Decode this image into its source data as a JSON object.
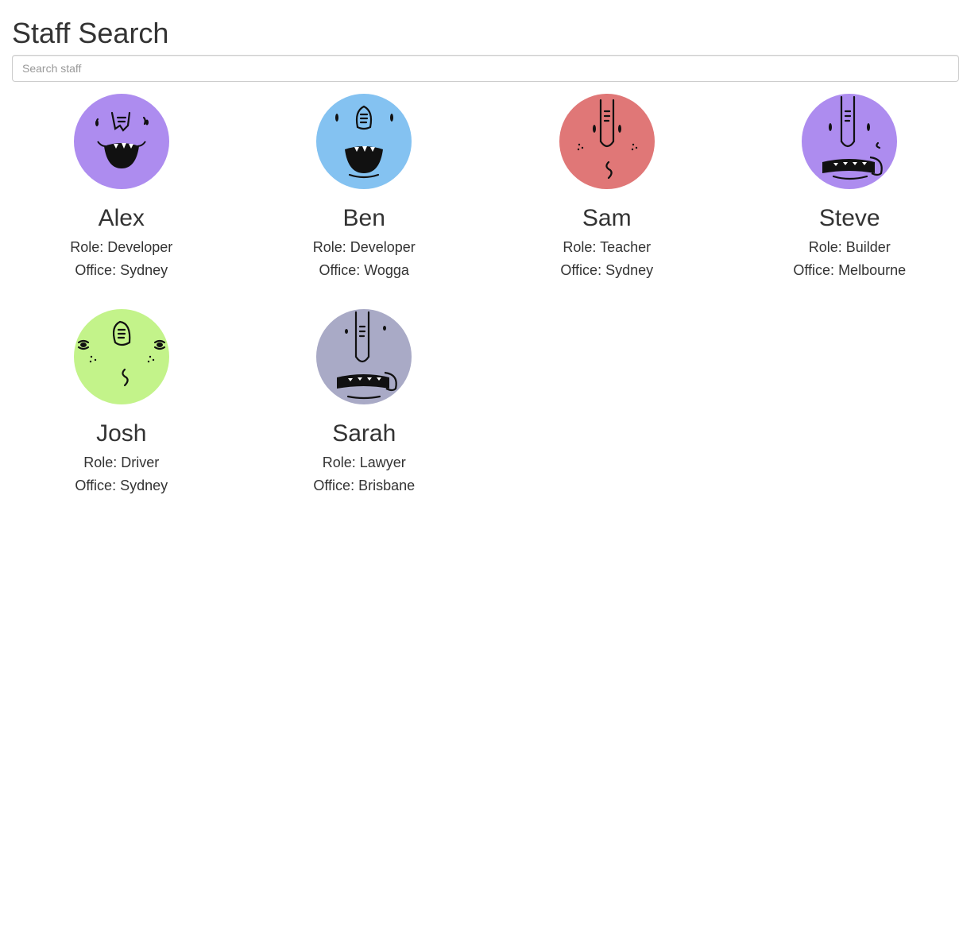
{
  "page": {
    "title": "Staff Search"
  },
  "search": {
    "placeholder": "Search staff",
    "value": ""
  },
  "labels": {
    "role_prefix": "Role: ",
    "office_prefix": "Office: "
  },
  "staff": [
    {
      "name": "Alex",
      "role": "Developer",
      "office": "Sydney",
      "avatar_color": "#ad8cef",
      "avatar_icon": "monster-face-icon"
    },
    {
      "name": "Ben",
      "role": "Developer",
      "office": "Wogga",
      "avatar_color": "#84c2f1",
      "avatar_icon": "monster-face-icon"
    },
    {
      "name": "Sam",
      "role": "Teacher",
      "office": "Sydney",
      "avatar_color": "#e07777",
      "avatar_icon": "monster-face-icon"
    },
    {
      "name": "Steve",
      "role": "Builder",
      "office": "Melbourne",
      "avatar_color": "#ad8cef",
      "avatar_icon": "monster-face-icon"
    },
    {
      "name": "Josh",
      "role": "Driver",
      "office": "Sydney",
      "avatar_color": "#c3f38a",
      "avatar_icon": "monster-face-icon"
    },
    {
      "name": "Sarah",
      "role": "Lawyer",
      "office": "Brisbane",
      "avatar_color": "#a9aac6",
      "avatar_icon": "monster-face-icon"
    }
  ]
}
